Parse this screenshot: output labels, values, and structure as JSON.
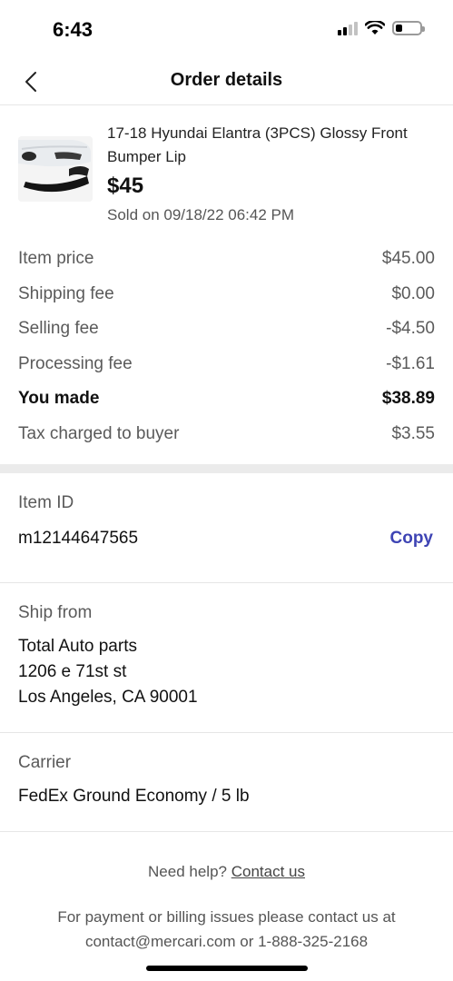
{
  "status_bar": {
    "time": "6:43",
    "icons": [
      "cellular-signal-icon",
      "wifi-icon",
      "battery-icon"
    ],
    "battery_level": 0.28
  },
  "nav": {
    "title": "Order details",
    "back_icon": "chevron-left-icon"
  },
  "item": {
    "title": "17-18 Hyundai Elantra (3PCS) Glossy Front Bumper Lip",
    "price": "$45",
    "sold_on": "Sold on 09/18/22 06:42 PM"
  },
  "fees": {
    "rows": [
      {
        "label": "Item price",
        "value": "$45.00"
      },
      {
        "label": "Shipping fee",
        "value": "$0.00"
      },
      {
        "label": "Selling fee",
        "value": "-$4.50"
      },
      {
        "label": "Processing fee",
        "value": "-$1.61"
      },
      {
        "label": "You made",
        "value": "$38.89"
      },
      {
        "label": "Tax charged to buyer",
        "value": "$3.55"
      }
    ]
  },
  "item_id": {
    "label": "Item ID",
    "value": "m12144647565",
    "copy_label": "Copy"
  },
  "ship_from": {
    "label": "Ship from",
    "lines": [
      "Total Auto parts",
      "1206 e 71st st",
      "Los Angeles, CA 90001"
    ]
  },
  "carrier": {
    "label": "Carrier",
    "value": "FedEx Ground Economy / 5 lb"
  },
  "help": {
    "prompt": "Need help?",
    "link": "Contact us",
    "note_line1": "For payment or billing issues please contact us at",
    "note_line2": "contact@mercari.com or 1-888-325-2168"
  },
  "colors": {
    "accent": "#3e44b4",
    "divider": "#ebebeb"
  }
}
